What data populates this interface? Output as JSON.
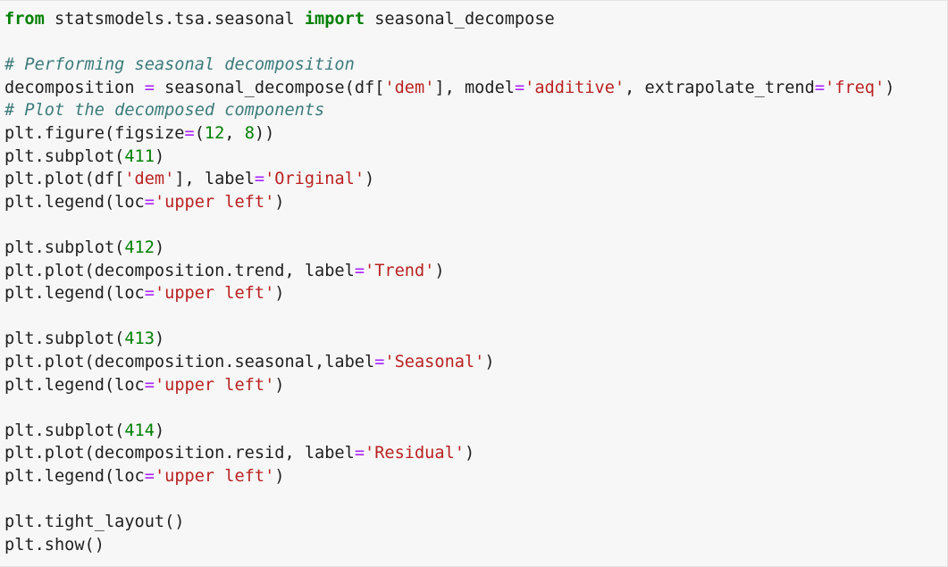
{
  "cell": {
    "lines": [
      [
        {
          "t": "from",
          "k": "kw"
        },
        {
          "t": " statsmodels.tsa.seasonal ",
          "k": "pl"
        },
        {
          "t": "import",
          "k": "kw"
        },
        {
          "t": " seasonal_decompose",
          "k": "pl"
        }
      ],
      [],
      [
        {
          "t": "# Performing seasonal decomposition",
          "k": "cm"
        }
      ],
      [
        {
          "t": "decomposition ",
          "k": "pl"
        },
        {
          "t": "=",
          "k": "op"
        },
        {
          "t": " seasonal_decompose(df[",
          "k": "pl"
        },
        {
          "t": "'dem'",
          "k": "st"
        },
        {
          "t": "], model",
          "k": "pl"
        },
        {
          "t": "=",
          "k": "op"
        },
        {
          "t": "'additive'",
          "k": "st"
        },
        {
          "t": ", extrapolate_trend",
          "k": "pl"
        },
        {
          "t": "=",
          "k": "op"
        },
        {
          "t": "'freq'",
          "k": "st"
        },
        {
          "t": ")",
          "k": "pl"
        }
      ],
      [
        {
          "t": "# Plot the decomposed components",
          "k": "cm"
        }
      ],
      [
        {
          "t": "plt.figure(figsize",
          "k": "pl"
        },
        {
          "t": "=",
          "k": "op"
        },
        {
          "t": "(",
          "k": "pl"
        },
        {
          "t": "12",
          "k": "nu"
        },
        {
          "t": ", ",
          "k": "pl"
        },
        {
          "t": "8",
          "k": "nu"
        },
        {
          "t": "))",
          "k": "pl"
        }
      ],
      [
        {
          "t": "plt.subplot(",
          "k": "pl"
        },
        {
          "t": "411",
          "k": "nu"
        },
        {
          "t": ")",
          "k": "pl"
        }
      ],
      [
        {
          "t": "plt.plot(df[",
          "k": "pl"
        },
        {
          "t": "'dem'",
          "k": "st"
        },
        {
          "t": "], label",
          "k": "pl"
        },
        {
          "t": "=",
          "k": "op"
        },
        {
          "t": "'Original'",
          "k": "st"
        },
        {
          "t": ")",
          "k": "pl"
        }
      ],
      [
        {
          "t": "plt.legend(loc",
          "k": "pl"
        },
        {
          "t": "=",
          "k": "op"
        },
        {
          "t": "'upper left'",
          "k": "st"
        },
        {
          "t": ")",
          "k": "pl"
        }
      ],
      [],
      [
        {
          "t": "plt.subplot(",
          "k": "pl"
        },
        {
          "t": "412",
          "k": "nu"
        },
        {
          "t": ")",
          "k": "pl"
        }
      ],
      [
        {
          "t": "plt.plot(decomposition.trend, label",
          "k": "pl"
        },
        {
          "t": "=",
          "k": "op"
        },
        {
          "t": "'Trend'",
          "k": "st"
        },
        {
          "t": ")",
          "k": "pl"
        }
      ],
      [
        {
          "t": "plt.legend(loc",
          "k": "pl"
        },
        {
          "t": "=",
          "k": "op"
        },
        {
          "t": "'upper left'",
          "k": "st"
        },
        {
          "t": ")",
          "k": "pl"
        }
      ],
      [],
      [
        {
          "t": "plt.subplot(",
          "k": "pl"
        },
        {
          "t": "413",
          "k": "nu"
        },
        {
          "t": ")",
          "k": "pl"
        }
      ],
      [
        {
          "t": "plt.plot(decomposition.seasonal,label",
          "k": "pl"
        },
        {
          "t": "=",
          "k": "op"
        },
        {
          "t": "'Seasonal'",
          "k": "st"
        },
        {
          "t": ")",
          "k": "pl"
        }
      ],
      [
        {
          "t": "plt.legend(loc",
          "k": "pl"
        },
        {
          "t": "=",
          "k": "op"
        },
        {
          "t": "'upper left'",
          "k": "st"
        },
        {
          "t": ")",
          "k": "pl"
        }
      ],
      [],
      [
        {
          "t": "plt.subplot(",
          "k": "pl"
        },
        {
          "t": "414",
          "k": "nu"
        },
        {
          "t": ")",
          "k": "pl"
        }
      ],
      [
        {
          "t": "plt.plot(decomposition.resid, label",
          "k": "pl"
        },
        {
          "t": "=",
          "k": "op"
        },
        {
          "t": "'Residual'",
          "k": "st"
        },
        {
          "t": ")",
          "k": "pl"
        }
      ],
      [
        {
          "t": "plt.legend(loc",
          "k": "pl"
        },
        {
          "t": "=",
          "k": "op"
        },
        {
          "t": "'upper left'",
          "k": "st"
        },
        {
          "t": ")",
          "k": "pl"
        }
      ],
      [],
      [
        {
          "t": "plt.tight_layout()",
          "k": "pl"
        }
      ],
      [
        {
          "t": "plt.show()",
          "k": "pl"
        }
      ]
    ]
  },
  "colors": {
    "cell_background": "#f7f7f7",
    "keyword": "#008000",
    "comment": "#3d7b7b",
    "string": "#ba2121",
    "number": "#008000",
    "operator": "#aa22ff",
    "text": "#1f1f1f"
  }
}
